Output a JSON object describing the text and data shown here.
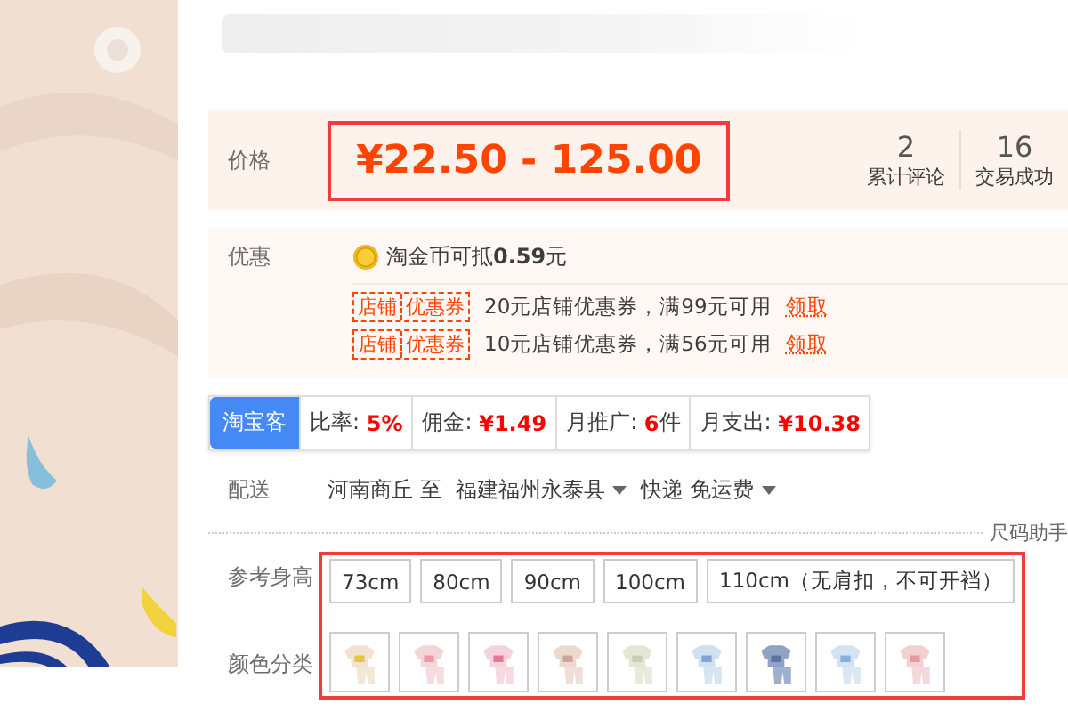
{
  "price": {
    "label": "价格",
    "value": "¥22.50 - 125.00",
    "highlighted": true
  },
  "stats": [
    {
      "value": "2",
      "label": "累计评论"
    },
    {
      "value": "16",
      "label": "交易成功"
    }
  ],
  "promo": {
    "label": "优惠",
    "coin_text": "淘金币可抵**0.59**元",
    "coupons": [
      {
        "tag_left": "店铺",
        "tag_right": "优惠券",
        "text": "20元店铺优惠券，满99元可用",
        "link": "领取"
      },
      {
        "tag_left": "店铺",
        "tag_right": "优惠券",
        "text": "10元店铺优惠券，满56元可用",
        "link": "领取"
      }
    ]
  },
  "affiliate": {
    "badge": "淘宝客",
    "items": [
      {
        "label": "比率:",
        "value": "5%"
      },
      {
        "label": "佣金:",
        "value": "¥1.49"
      },
      {
        "label": "月推广:",
        "value": "6",
        "unit": "件"
      },
      {
        "label": "月支出:",
        "value": "¥10.38"
      }
    ]
  },
  "shipping": {
    "label": "配送",
    "from": "河南商丘 至",
    "to": "福建福州永泰县",
    "method": "快递 免运费"
  },
  "size_helper": "尺码助手",
  "options": {
    "highlighted": true,
    "size_label": "参考身高",
    "sizes": [
      "73cm",
      "80cm",
      "90cm",
      "100cm",
      "110cm（无肩扣，不可开裆）"
    ],
    "color_label": "颜色分类"
  }
}
